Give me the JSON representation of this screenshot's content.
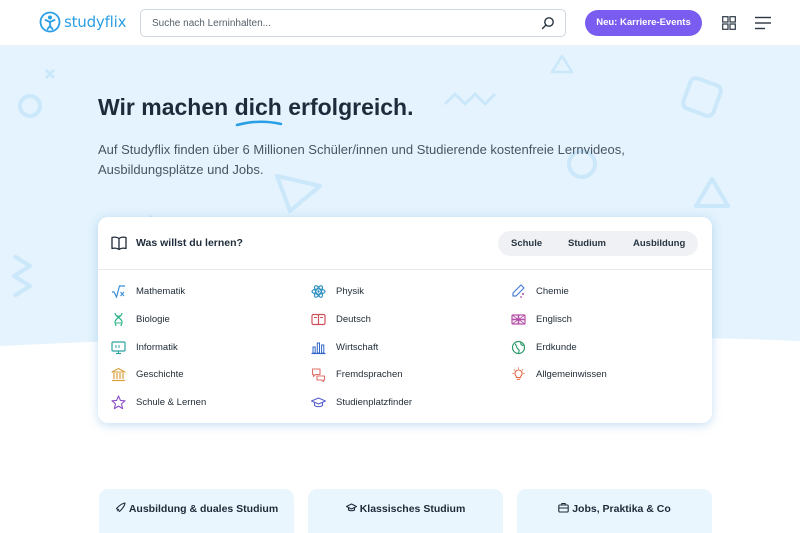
{
  "header": {
    "logo_text": "studyflix",
    "search_placeholder": "Suche nach Lerninhalten...",
    "events_button": "Neu: Karriere-Events",
    "icons": [
      "logo-icon",
      "search-icon",
      "grid-icon",
      "menu-icon"
    ]
  },
  "hero": {
    "title_before": "Wir machen ",
    "title_highlight": "dich",
    "title_after": " erfolgreich.",
    "description": "Auf Studyflix finden über 6 Millionen Schüler/innen und Studierende kostenfreie Lernvideos, Ausbildungsplätze und Jobs."
  },
  "card": {
    "title": "Was willst du lernen?",
    "tabs": [
      "Schule",
      "Studium",
      "Ausbildung"
    ],
    "subjects": [
      {
        "label": "Mathematik",
        "icon": "sqrt-icon",
        "color": "#3a8fd6"
      },
      {
        "label": "Physik",
        "icon": "atom-icon",
        "color": "#2b8fc0"
      },
      {
        "label": "Chemie",
        "icon": "flask-icon",
        "color": "#4a7fd9"
      },
      {
        "label": "Biologie",
        "icon": "dna-icon",
        "color": "#2bb38a"
      },
      {
        "label": "Deutsch",
        "icon": "book-open-icon",
        "color": "#d0505a"
      },
      {
        "label": "Englisch",
        "icon": "flag-uk-icon",
        "color": "#b64fa8"
      },
      {
        "label": "Informatik",
        "icon": "monitor-icon",
        "color": "#2ca4a0"
      },
      {
        "label": "Wirtschaft",
        "icon": "bar-chart-icon",
        "color": "#3266c8"
      },
      {
        "label": "Erdkunde",
        "icon": "globe-icon",
        "color": "#2c9a6a"
      },
      {
        "label": "Geschichte",
        "icon": "temple-icon",
        "color": "#d8a03a"
      },
      {
        "label": "Fremdsprachen",
        "icon": "speech-bubbles-icon",
        "color": "#e0706a"
      },
      {
        "label": "Allgemeinwissen",
        "icon": "lightbulb-icon",
        "color": "#e86a4a"
      },
      {
        "label": "Schule & Lernen",
        "icon": "star-icon",
        "color": "#8a4fc8"
      },
      {
        "label": "Studienplatzfinder",
        "icon": "graduation-cap-icon",
        "color": "#5a5fd0"
      }
    ]
  },
  "bottom_cards": [
    {
      "label": "Ausbildung & duales Studium",
      "icon": "rocket-icon"
    },
    {
      "label": "Klassisches Studium",
      "icon": "graduation-cap-icon"
    },
    {
      "label": "Jobs, Praktika & Co",
      "icon": "briefcase-icon"
    }
  ],
  "colors": {
    "brand": "#2b9fe5",
    "accent": "#7b5cf0",
    "hero_bg": "#e4f3fd",
    "card_bg": "#e9f6fd"
  }
}
